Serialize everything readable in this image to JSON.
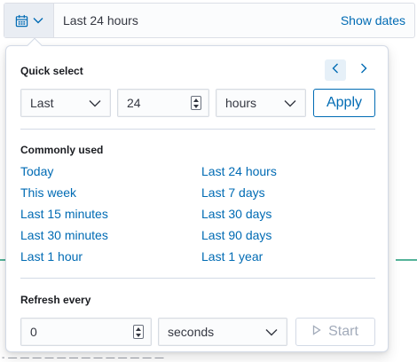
{
  "date_bar": {
    "range_text": "Last 24 hours",
    "show_dates_label": "Show dates"
  },
  "quick_select": {
    "title": "Quick select",
    "unit_direction": "Last",
    "amount": "24",
    "unit": "hours",
    "apply_label": "Apply"
  },
  "commonly_used": {
    "title": "Commonly used",
    "left": [
      "Today",
      "This week",
      "Last 15 minutes",
      "Last 30 minutes",
      "Last 1 hour"
    ],
    "right": [
      "Last 24 hours",
      "Last 7 days",
      "Last 30 days",
      "Last 90 days",
      "Last 1 year"
    ]
  },
  "refresh": {
    "title": "Refresh every",
    "interval": "0",
    "unit": "seconds",
    "start_label": "Start"
  },
  "colors": {
    "link": "#006bb4",
    "accent_bg": "#e6f0f8",
    "text": "#343741",
    "disabled": "#a2abba",
    "chart_line": "#54b399"
  },
  "background": {
    "strip_text": "-   ―   ―    ―    ―   ―   ―   ―   ―  ―   ―   ―  ―   ―"
  }
}
